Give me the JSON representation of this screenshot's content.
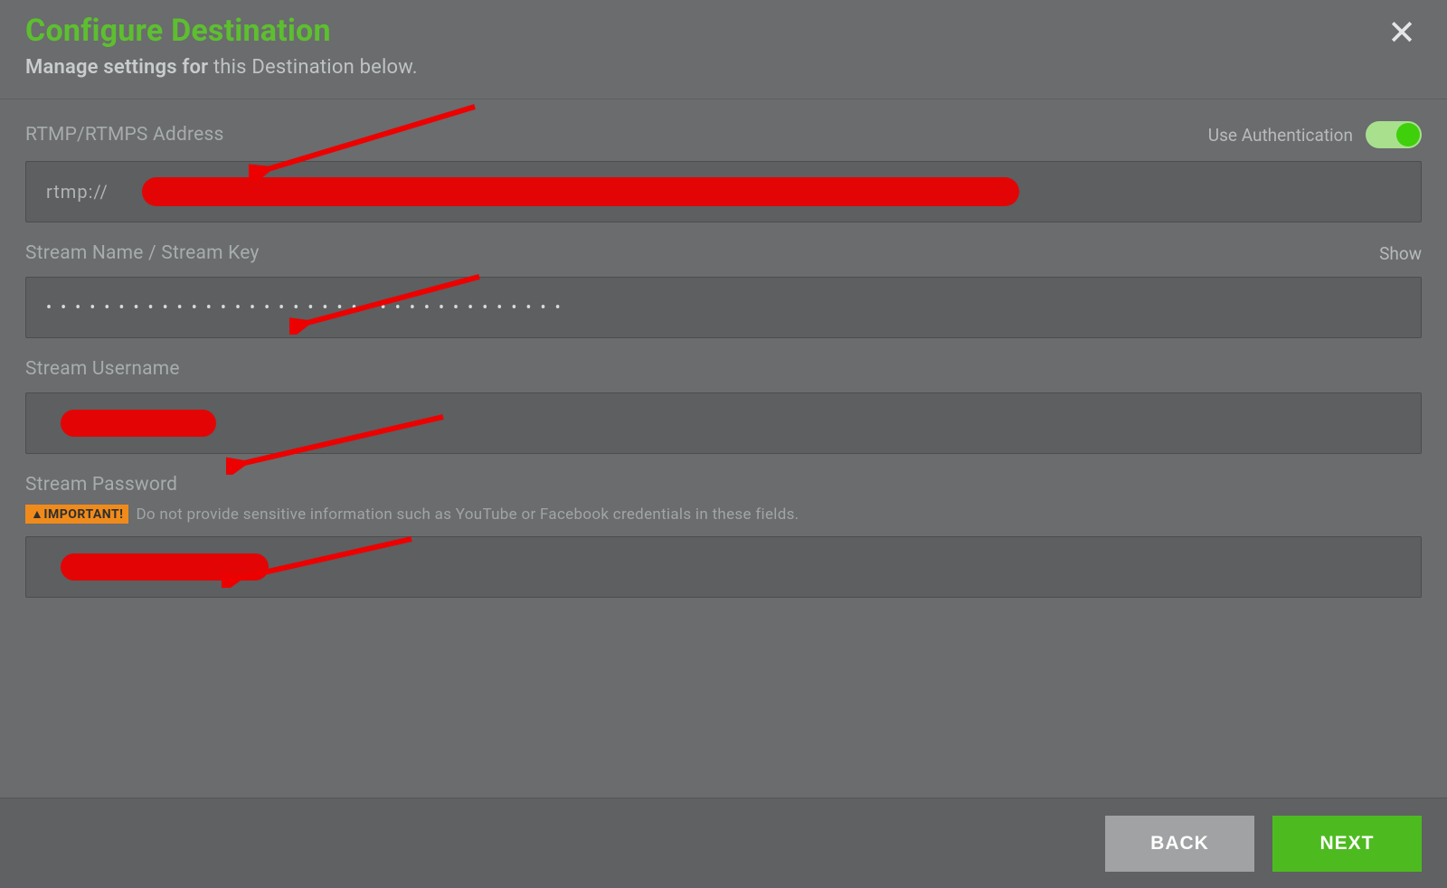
{
  "header": {
    "title": "Configure Destination",
    "subtitle_bold": "Manage settings for",
    "subtitle_rest": " this Destination below."
  },
  "fields": {
    "rtmp_label": "RTMP/RTMPS Address",
    "auth_label": "Use Authentication",
    "rtmp_value_prefix": "rtmp://",
    "streamkey_label": "Stream Name / Stream Key",
    "streamkey_value": "••••••••••••••••••••••••••••••••••••",
    "show_label": "Show",
    "username_label": "Stream Username",
    "password_label": "Stream Password",
    "important_badge": "▲IMPORTANT!",
    "important_text": "Do not provide sensitive information such as YouTube or Facebook credentials in these fields."
  },
  "footer": {
    "back": "BACK",
    "next": "NEXT"
  },
  "colors": {
    "accent_green": "#4dbb1f",
    "redact_red": "#e30505",
    "warn_orange": "#f08b1b"
  }
}
